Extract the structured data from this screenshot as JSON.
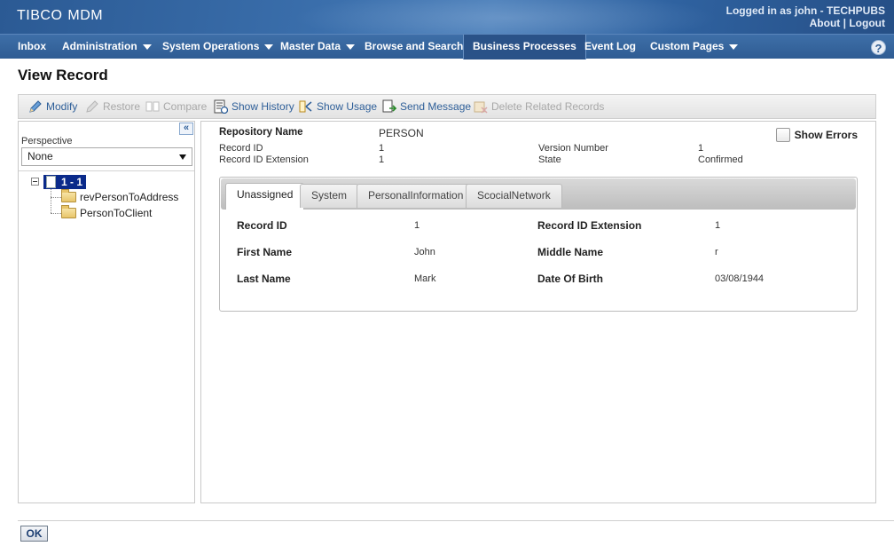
{
  "header": {
    "logo_brand": "TIBCO",
    "logo_product": "MDM",
    "logged_in_prefix": "Logged in as",
    "logged_in_user": "john - TECHPUBS",
    "about_label": "About",
    "link_separator": "|",
    "logout_label": "Logout"
  },
  "nav": {
    "items": [
      {
        "label": "Inbox"
      },
      {
        "label": "Administration"
      },
      {
        "label": "System Operations"
      },
      {
        "label": "Master Data"
      },
      {
        "label": "Browse and Search"
      },
      {
        "label": "Business Processes"
      },
      {
        "label": "Event Log"
      },
      {
        "label": "Custom Pages"
      }
    ],
    "help_glyph": "?"
  },
  "page": {
    "title": "View Record"
  },
  "toolbar": {
    "modify": "Modify",
    "restore": "Restore",
    "compare": "Compare",
    "show_history": "Show History",
    "show_usage": "Show Usage",
    "send_message": "Send Message",
    "delete_related": "Delete Related Records"
  },
  "left": {
    "collapse_glyph": "«",
    "perspective_label": "Perspective",
    "perspective_value": "None",
    "tree_root": "1 - 1",
    "tree_children": [
      "revPersonToAddress",
      "PersonToClient"
    ]
  },
  "record": {
    "repository_name_label": "Repository Name",
    "repository_name_value": "PERSON",
    "record_id_label": "Record ID",
    "record_id_value": "1",
    "record_id_ext_label": "Record ID Extension",
    "record_id_ext_value": "1",
    "version_number_label": "Version Number",
    "version_number_value": "1",
    "state_label": "State",
    "state_value": "Confirmed",
    "show_errors_label": "Show Errors"
  },
  "tabs": [
    "Unassigned",
    "System",
    "PersonalInformation",
    "ScocialNetwork"
  ],
  "fields": {
    "record_id_label": "Record ID",
    "record_id_value": "1",
    "record_id_ext_label": "Record ID Extension",
    "record_id_ext_value": "1",
    "first_name_label": "First Name",
    "first_name_value": "John",
    "middle_name_label": "Middle Name",
    "middle_name_value": "r",
    "last_name_label": "Last Name",
    "last_name_value": "Mark",
    "dob_label": "Date Of Birth",
    "dob_value": "03/08/1944"
  },
  "footer": {
    "ok_label": "OK"
  },
  "colors": {
    "nav_bg": "#2f5c93",
    "link": "#2e5f99",
    "tree_selected": "#0a2a8a"
  }
}
